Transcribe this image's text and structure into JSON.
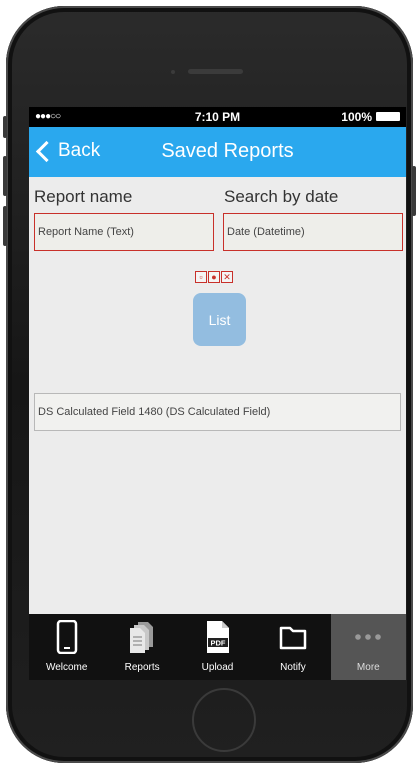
{
  "status_bar": {
    "signal": "●●●○○",
    "time": "7:10 PM",
    "battery": "100%"
  },
  "nav": {
    "back_label": "Back",
    "title": "Saved Reports",
    "color": "#2aa8ee"
  },
  "form": {
    "report_name_label": "Report name",
    "report_name_value": "Report Name (Text)",
    "search_date_label": "Search by date",
    "search_date_value": "Date (Datetime)",
    "calculated_field_value": "DS Calculated Field 1480 (DS Calculated Field)"
  },
  "list_button": {
    "label": "List",
    "mini_icons": [
      "copy-icon",
      "record-icon",
      "close-icon"
    ]
  },
  "tabbar": {
    "items": [
      {
        "label": "Welcome",
        "icon": "phone-icon"
      },
      {
        "label": "Reports",
        "icon": "documents-icon"
      },
      {
        "label": "Upload",
        "icon": "pdf-icon"
      },
      {
        "label": "Notify",
        "icon": "folder-icon"
      },
      {
        "label": "More",
        "icon": "more-dots-icon"
      }
    ]
  }
}
